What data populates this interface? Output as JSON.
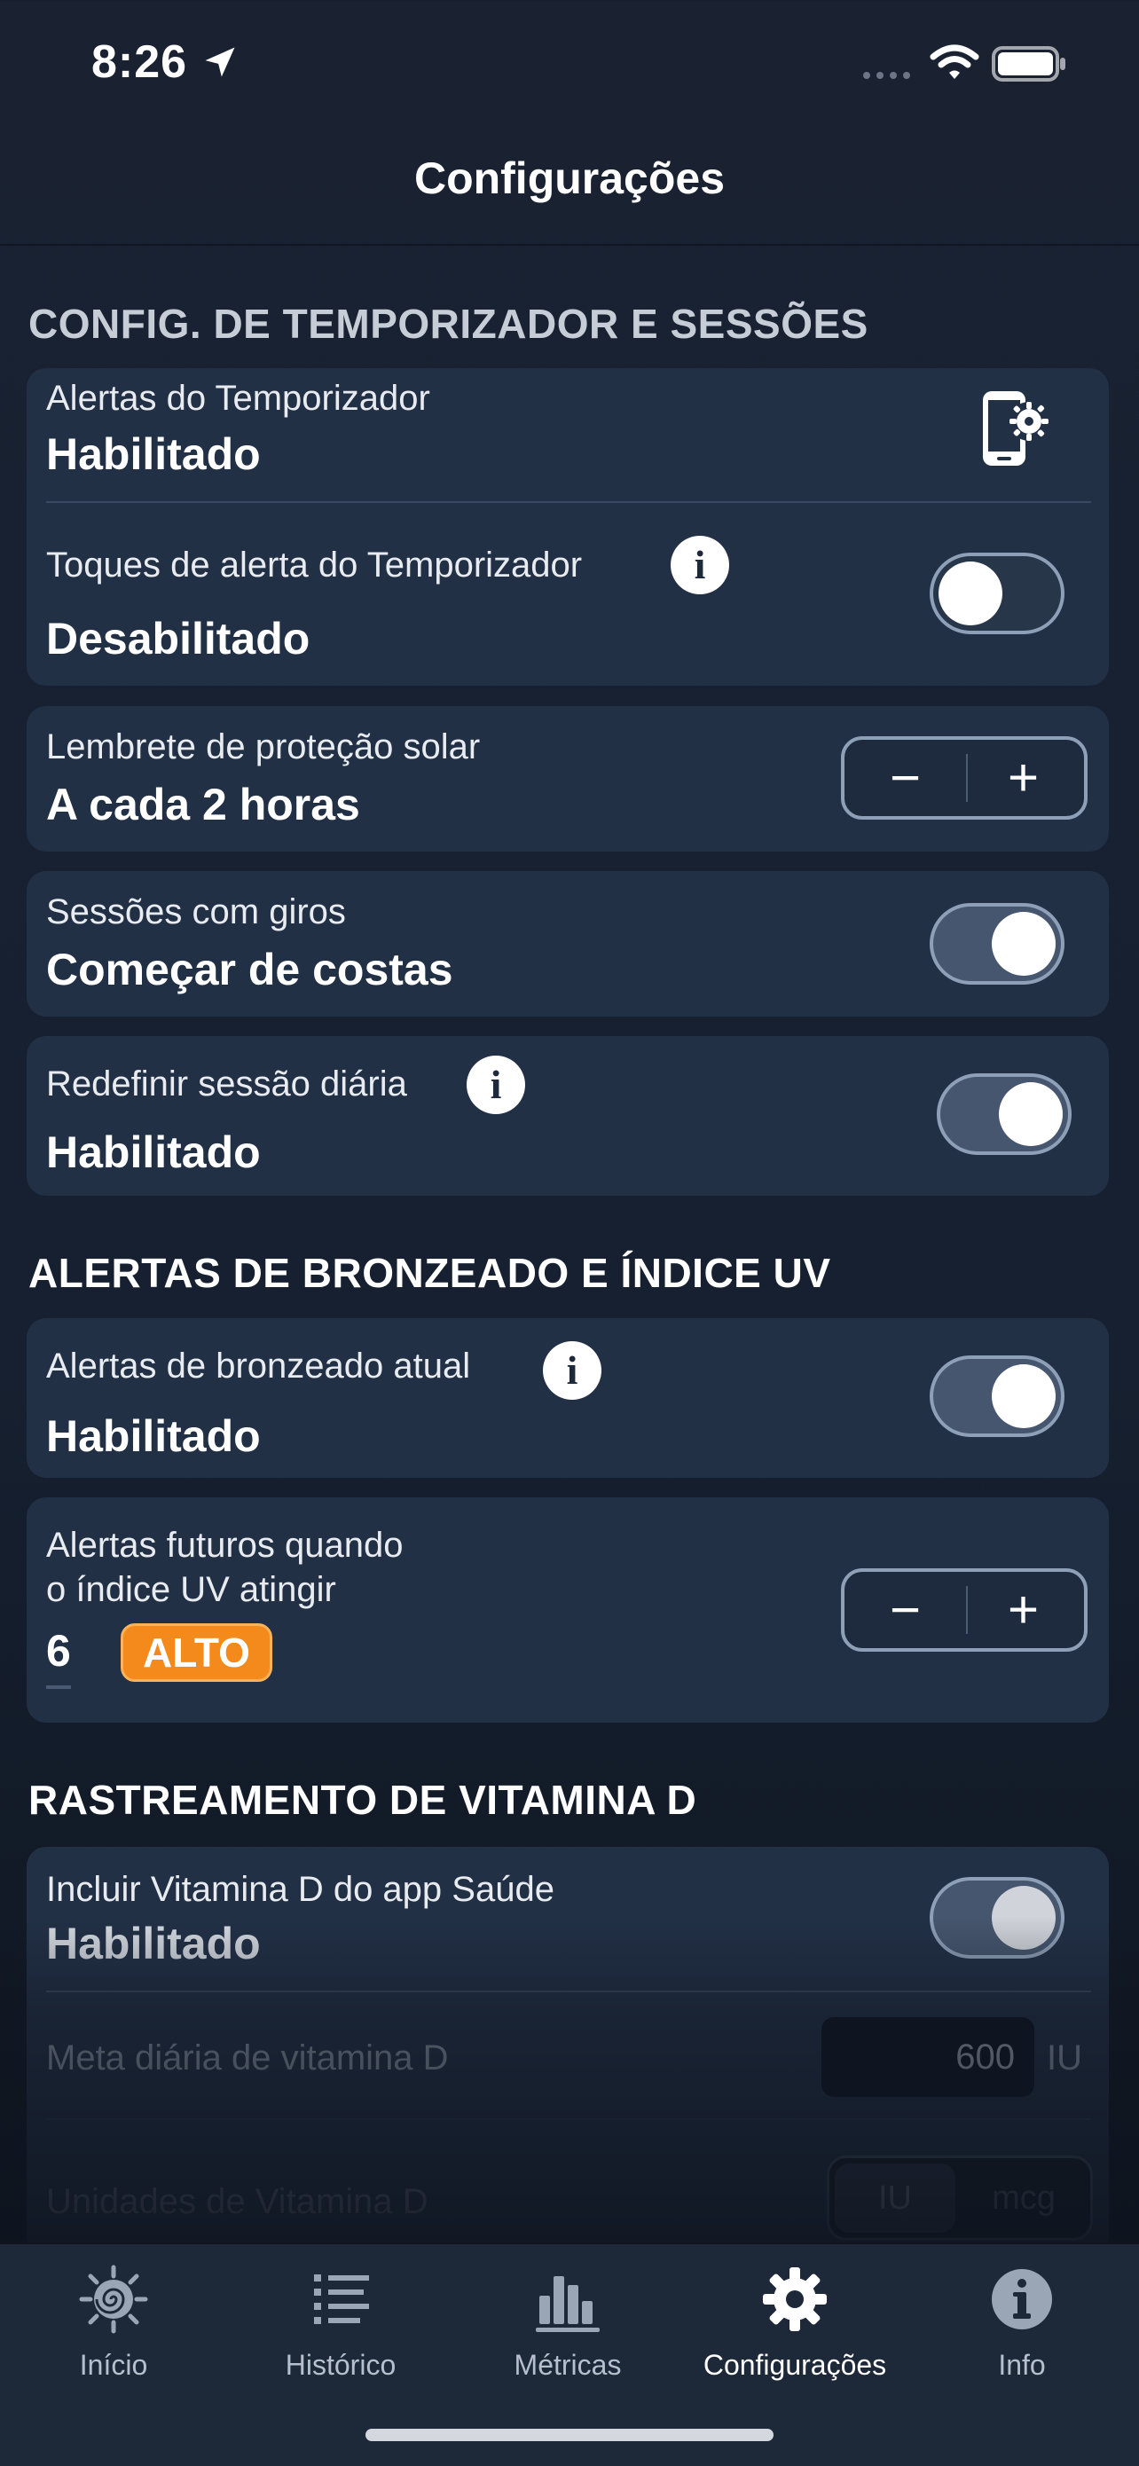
{
  "status_bar": {
    "time": "8:26"
  },
  "nav": {
    "title": "Configurações"
  },
  "sections": {
    "timer": {
      "header": "CONFIG. DE TEMPORIZADOR E SESSÕES",
      "timer_alerts": {
        "label": "Alertas do Temporizador",
        "value": "Habilitado"
      },
      "timer_tones": {
        "label": "Toques de alerta do Temporizador",
        "value": "Desabilitado",
        "enabled": false
      },
      "sunscreen": {
        "label": "Lembrete de proteção solar",
        "value": "A cada 2 horas",
        "minus": "−",
        "plus": "+"
      },
      "turns": {
        "label": "Sessões com giros",
        "value": "Começar de costas",
        "enabled": true
      },
      "daily_reset": {
        "label": "Redefinir sessão diária",
        "value": "Habilitado",
        "enabled": true
      }
    },
    "uv": {
      "header": "ALERTAS DE BRONZEADO E ÍNDICE UV",
      "current_alerts": {
        "label": "Alertas de bronzeado atual",
        "value": "Habilitado",
        "enabled": true
      },
      "future_alerts": {
        "label_line1": "Alertas futuros quando",
        "label_line2": "o índice UV atingir",
        "uv_value": "6",
        "uv_level": "ALTO",
        "minus": "−",
        "plus": "+"
      }
    },
    "vitamin_d": {
      "header": "RASTREAMENTO DE VITAMINA D",
      "include_health": {
        "label": "Incluir Vitamina D do app Saúde",
        "value": "Habilitado",
        "enabled": true
      },
      "daily_goal": {
        "label": "Meta diária de vitamina D",
        "value": "600",
        "unit": "IU"
      },
      "units": {
        "label": "Unidades de Vitamina D",
        "options": [
          "IU",
          "mcg"
        ],
        "selected": "IU"
      }
    }
  },
  "tabs": [
    {
      "label": "Início",
      "icon": "sun-spiral-icon"
    },
    {
      "label": "Histórico",
      "icon": "list-icon"
    },
    {
      "label": "Métricas",
      "icon": "bar-chart-icon"
    },
    {
      "label": "Configurações",
      "icon": "gear-icon",
      "active": true
    },
    {
      "label": "Info",
      "icon": "info-icon"
    }
  ],
  "colors": {
    "accent_orange": "#f48a1c",
    "card_bg": "#223046",
    "background": "#1a2232"
  }
}
